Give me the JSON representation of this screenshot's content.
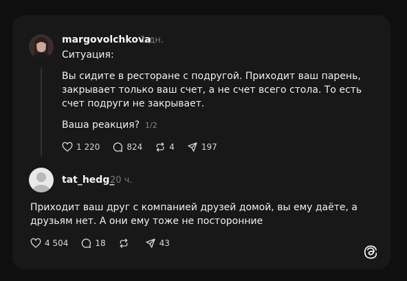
{
  "post1": {
    "username": "margovolchkova",
    "time": "1 дн.",
    "intro": "Ситуация:",
    "body": "Вы сидите в ресторане с подругой. Приходит ваш парень, закрывает только ваш счет, а не счет всего стола. То есть счет подруги не закрывает.",
    "question": "Ваша реакция?",
    "pager": "1/2",
    "likes": "1 220",
    "replies": "824",
    "reposts": "4",
    "shares": "197"
  },
  "post2": {
    "username": "tat_hedg_",
    "time": "20 ч.",
    "body": "Приходит ваш друг с компанией друзей домой, вы ему даёте, а друзьям нет. А они ему тоже не посторонние",
    "likes": "4 504",
    "replies": "18",
    "shares": "43"
  },
  "icons": {
    "like": "heart-icon",
    "reply": "comment-icon",
    "repost": "repost-icon",
    "share": "send-icon",
    "logo": "threads-logo-icon"
  },
  "colors": {
    "background": "#0f0f0f",
    "card": "#181818",
    "text": "#f0f0f0",
    "muted": "#7a7a7a"
  }
}
